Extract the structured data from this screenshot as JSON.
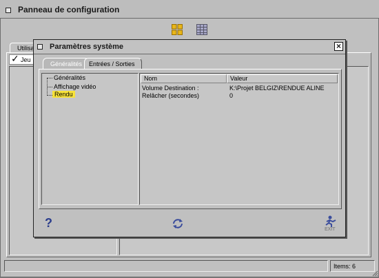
{
  "outer_window": {
    "title": "Panneau de configuration",
    "tab_label": "Utilisa",
    "check_item_label": "Jeu",
    "status_text": "Items: 6"
  },
  "dialog": {
    "title": "Paramètres système",
    "close_glyph": "×",
    "tabs": [
      {
        "label": "Généralités"
      },
      {
        "label": "Entrées / Sorties"
      }
    ],
    "tree": [
      {
        "label": "Généralités"
      },
      {
        "label": "Affichage vidéo"
      },
      {
        "label": "Rendu"
      }
    ],
    "table": {
      "columns": [
        "Nom",
        "Valeur"
      ],
      "rows": [
        {
          "name": "Volume Destination :",
          "value": "K:\\Projet BELGIZ\\RENDUE ALINE"
        },
        {
          "name": "Relâcher (secondes)",
          "value": "0"
        }
      ]
    },
    "footer": {
      "help_glyph": "?",
      "exit_label": "EXIT"
    }
  },
  "icons": {
    "view_grid": "grid-view-icon",
    "view_list": "list-view-icon",
    "help": "help-icon",
    "refresh": "refresh-icon",
    "exit": "exit-icon"
  },
  "colors": {
    "desktop": "#7a7a7a",
    "window": "#c0c0c0",
    "highlight": "#f7e23a",
    "active_tab": "#bdbdbd",
    "inactive_tab_text": "#ffffff"
  }
}
